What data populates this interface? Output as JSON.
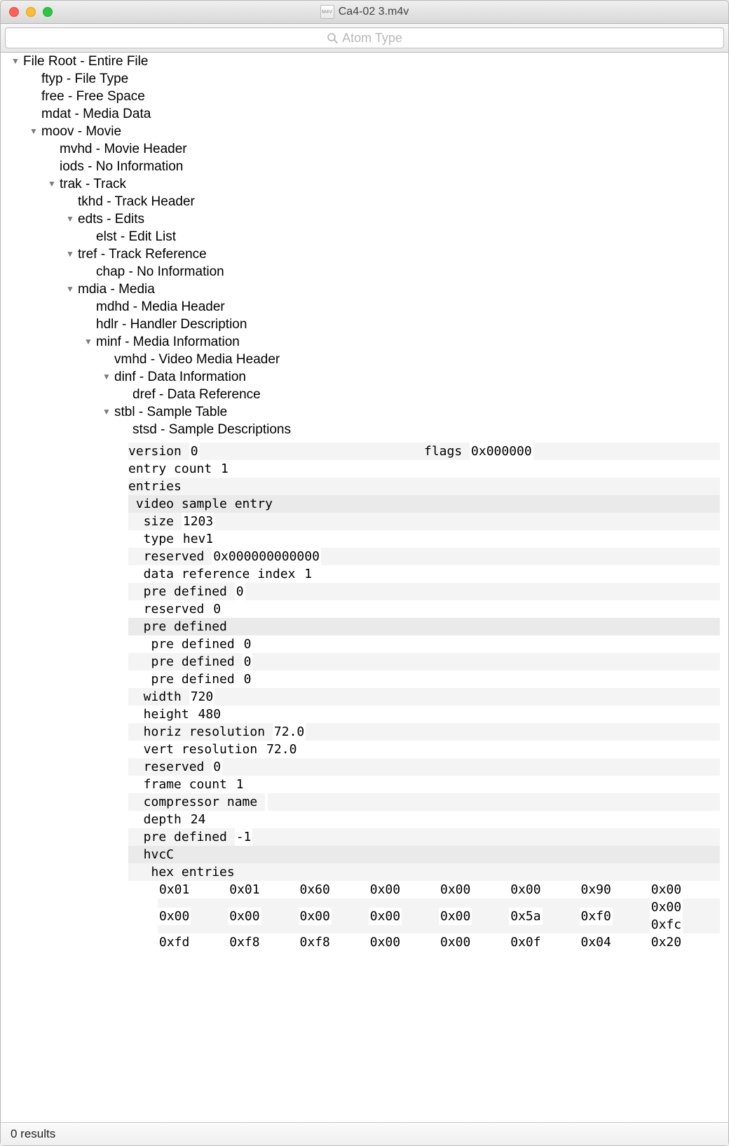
{
  "window": {
    "title": "Ca4-02 3.m4v"
  },
  "search": {
    "placeholder": "Atom Type"
  },
  "tree": {
    "root": "File Root - Entire File",
    "ftyp": "ftyp - File Type",
    "free": "free - Free Space",
    "mdat": "mdat - Media Data",
    "moov": "moov - Movie",
    "mvhd": "mvhd - Movie Header",
    "iods": "iods - No Information",
    "trak": "trak - Track",
    "tkhd": "tkhd - Track Header",
    "edts": "edts - Edits",
    "elst": "elst - Edit List",
    "tref": "tref - Track Reference",
    "chap": "chap - No Information",
    "mdia": "mdia - Media",
    "mdhd": "mdhd - Media Header",
    "hdlr": "hdlr - Handler Description",
    "minf": "minf - Media Information",
    "vmhd": "vmhd - Video Media Header",
    "dinf": "dinf - Data Information",
    "dref": "dref - Data Reference",
    "stbl": "stbl - Sample Table",
    "stsd": "stsd - Sample Descriptions"
  },
  "d": {
    "version_k": "version ",
    "version_v": "0",
    "flags_k": "flags ",
    "flags_v": "0x000000",
    "entry_count_k": "entry count ",
    "entry_count_v": "1",
    "entries_k": "entries",
    "vse_k": " video sample entry",
    "size_k": "  size ",
    "size_v": "1203",
    "type_k": "  type ",
    "type_v": "hev1",
    "reserved1_k": "  reserved ",
    "reserved1_v": "0x000000000000",
    "dri_k": "  data reference index ",
    "dri_v": "1",
    "pd1_k": "  pre defined ",
    "pd1_v": "0",
    "reserved2_k": "  reserved ",
    "reserved2_v": "0",
    "pdh_k": "  pre defined",
    "pda_k": "   pre defined ",
    "pda_v": "0",
    "pdb_k": "   pre defined ",
    "pdb_v": "0",
    "pdc_k": "   pre defined ",
    "pdc_v": "0",
    "width_k": "  width ",
    "width_v": "720",
    "height_k": "  height ",
    "height_v": "480",
    "hres_k": "  horiz resolution ",
    "hres_v": "72.0",
    "vres_k": "  vert resolution ",
    "vres_v": "72.0",
    "reserved3_k": "  reserved ",
    "reserved3_v": "0",
    "fc_k": "  frame count ",
    "fc_v": "1",
    "cn_k": "  compressor name ",
    "cn_v": "",
    "depth_k": "  depth ",
    "depth_v": "24",
    "pd2_k": "  pre defined ",
    "pd2_v": "-1",
    "hvcc_k": "  hvcC",
    "hexent_k": "   hex entries"
  },
  "hex": {
    "r0": [
      "0x01",
      "0x01",
      "0x60",
      "0x00",
      "0x00",
      "0x00",
      "0x90",
      "0x00"
    ],
    "r1": [
      "0x00",
      "0x00",
      "0x00",
      "0x00",
      "0x00",
      "0x5a",
      "0xf0",
      "0x00",
      "0xfc"
    ],
    "r2": [
      "0xfd",
      "0xf8",
      "0xf8",
      "0x00",
      "0x00",
      "0x0f",
      "0x04",
      "0x20"
    ]
  },
  "status": {
    "results": "0 results"
  }
}
